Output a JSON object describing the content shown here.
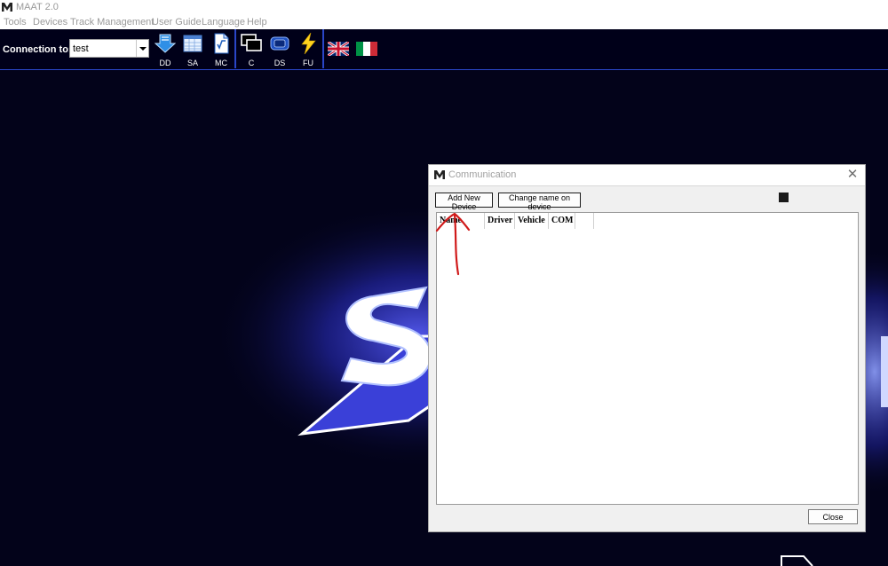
{
  "app": {
    "title": "MAAT 2.0"
  },
  "menu": {
    "items": [
      "Tools",
      "Devices",
      "Track Management",
      "User Guide",
      "Language",
      "Help"
    ]
  },
  "toolbar": {
    "connection_label": "Connection to:",
    "connection_value": "test",
    "buttons": [
      {
        "label": "DD",
        "icon": "download-data-icon"
      },
      {
        "label": "SA",
        "icon": "spreadsheet-icon"
      },
      {
        "label": "MC",
        "icon": "formula-document-icon"
      },
      {
        "label": "C",
        "icon": "communication-monitors-icon"
      },
      {
        "label": "DS",
        "icon": "device-settings-icon"
      },
      {
        "label": "FU",
        "icon": "lightning-bolt-icon"
      }
    ],
    "flags": [
      "uk-flag-icon",
      "italy-flag-icon"
    ]
  },
  "dialog": {
    "title": "Communication",
    "add_button": "Add New Device",
    "rename_button": "Change name on device",
    "columns": [
      "Name",
      "Driver",
      "Vehicle",
      "COM"
    ],
    "close_button": "Close"
  },
  "colors": {
    "background": "#03031a",
    "accent": "#2a46c8",
    "glow": "#4a50ff",
    "annotation": "#d01a1a"
  }
}
